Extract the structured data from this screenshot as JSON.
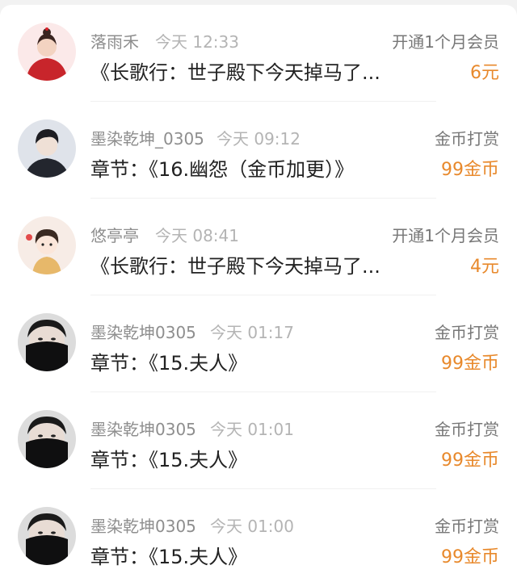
{
  "colors": {
    "amount": "#e8892c",
    "name": "#8e8e8e",
    "time": "#b4b4b4",
    "content": "#222222"
  },
  "records": [
    {
      "name": "落雨禾",
      "time": "今天 12:33",
      "action": "开通1个月会员",
      "content": "《长歌行：世子殿下今天掉马了...",
      "amount": "6元",
      "avatar": "red-dress-girl-avatar"
    },
    {
      "name": "墨染乾坤_0305",
      "time": "今天 09:12",
      "action": "金币打赏",
      "content": "章节：《16.幽怨（金币加更）》",
      "amount": "99金币",
      "avatar": "young-man-photo-avatar"
    },
    {
      "name": "悠亭亭",
      "time": "今天 08:41",
      "action": "开通1个月会员",
      "content": "《长歌行：世子殿下今天掉马了...",
      "amount": "4元",
      "avatar": "cartoon-girl-avatar"
    },
    {
      "name": "墨染乾坤0305",
      "time": "今天 01:17",
      "action": "金币打赏",
      "content": "章节：《15.夫人》",
      "amount": "99金币",
      "avatar": "masked-man-avatar"
    },
    {
      "name": "墨染乾坤0305",
      "time": "今天 01:01",
      "action": "金币打赏",
      "content": "章节：《15.夫人》",
      "amount": "99金币",
      "avatar": "masked-man-avatar"
    },
    {
      "name": "墨染乾坤0305",
      "time": "今天 01:00",
      "action": "金币打赏",
      "content": "章节：《15.夫人》",
      "amount": "99金币",
      "avatar": "masked-man-avatar"
    }
  ]
}
